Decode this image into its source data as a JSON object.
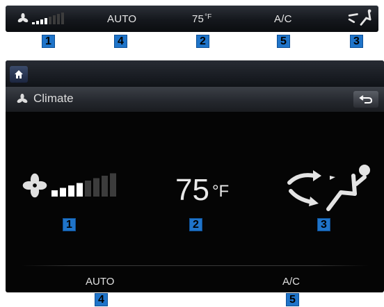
{
  "strip": {
    "fan_level": 4,
    "fan_levels_total": 8,
    "mode_label": "AUTO",
    "temperature": "75",
    "temperature_unit": "°F",
    "ac_label": "A/C",
    "icons": {
      "fan": "fan-icon",
      "airflow": "seat-airflow-icon"
    }
  },
  "callouts": [
    "1",
    "2",
    "3",
    "4",
    "5"
  ],
  "screen": {
    "home_icon": "home-icon",
    "title": "Climate",
    "title_icon": "fan-icon",
    "back_icon": "back-arrow-icon",
    "fan_level": 4,
    "fan_levels_total": 8,
    "temperature": "75",
    "temperature_unit": "°F",
    "airflow_icon": "seat-airflow-icon",
    "mode_label": "AUTO",
    "ac_label": "A/C"
  },
  "colors": {
    "callout_badge": "#1f74c9",
    "active_bar": "#ffffff",
    "inactive_bar": "#3c3c3c"
  }
}
